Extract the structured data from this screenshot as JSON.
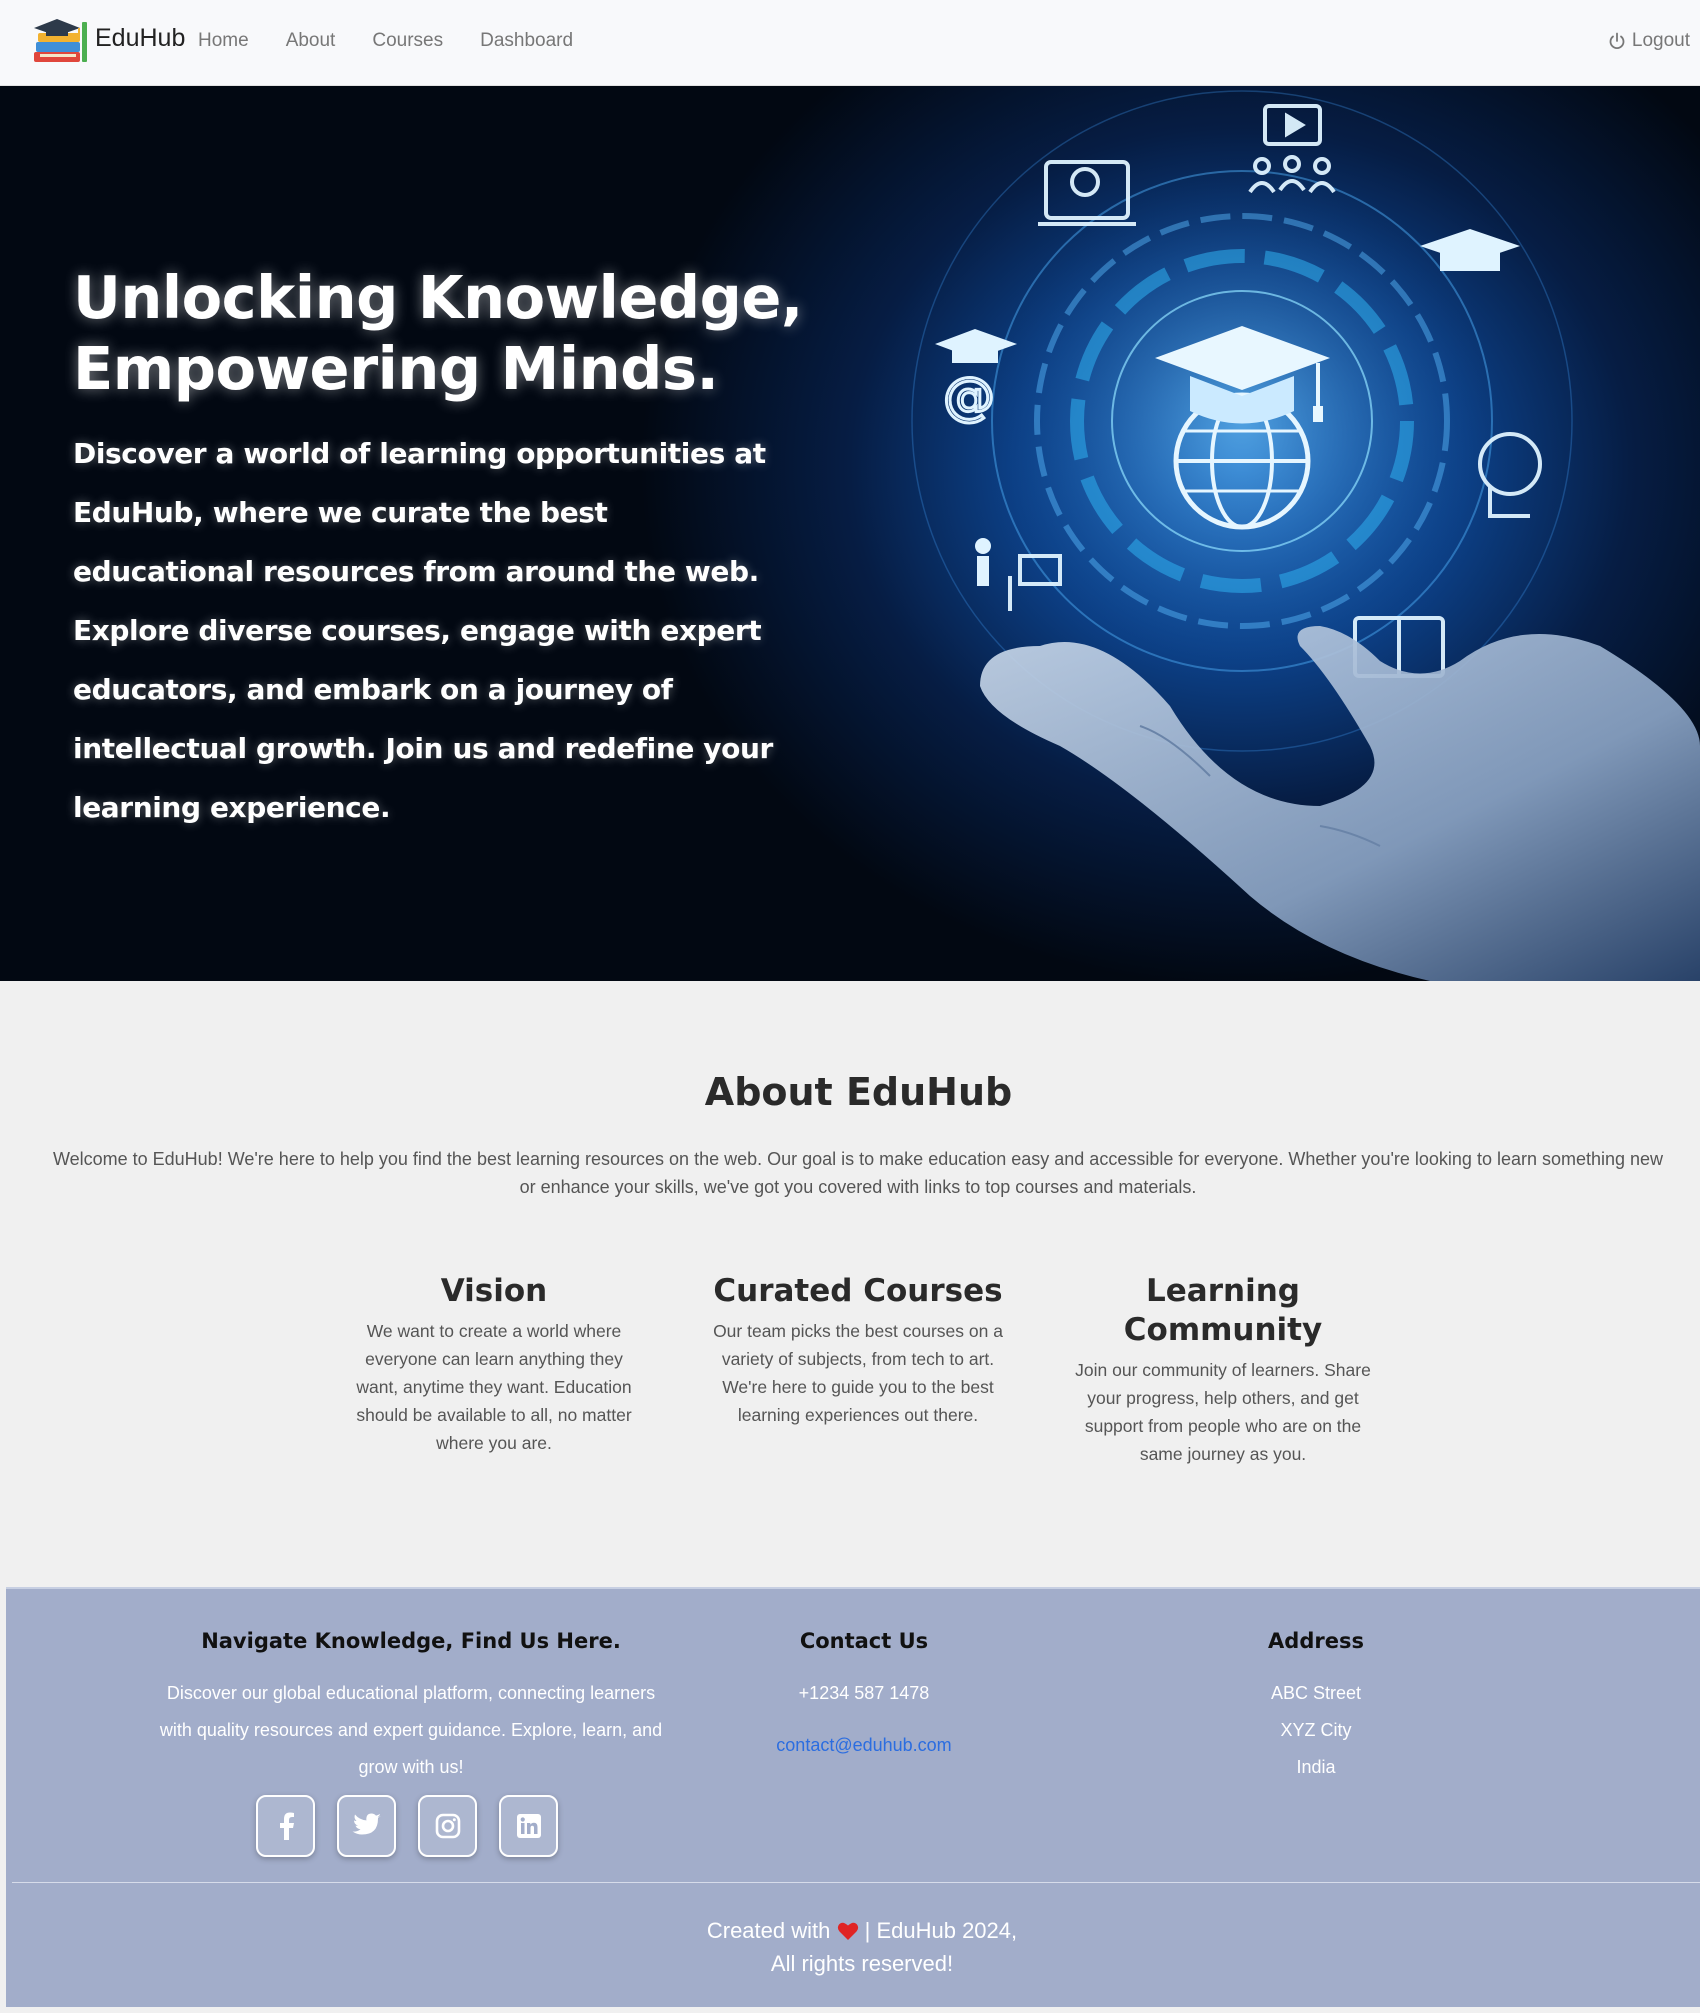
{
  "nav": {
    "brand": "EduHub",
    "links": [
      "Home",
      "About",
      "Courses",
      "Dashboard"
    ],
    "logout": "Logout"
  },
  "hero": {
    "title": "Unlocking Knowledge, Empowering Minds.",
    "text": "Discover a world of learning opportunities at EduHub, where we curate the best educational resources from around the web. Explore diverse courses, engage with expert educators, and embark on a journey of intellectual growth. Join us and redefine your learning experience."
  },
  "about": {
    "title": "About EduHub",
    "text": "Welcome to EduHub! We're here to help you find the best learning resources on the web. Our goal is to make education easy and accessible for everyone. Whether you're looking to learn something new or enhance your skills, we've got you covered with links to top courses and materials.",
    "columns": [
      {
        "title": "Vision",
        "text": "We want to create a world where everyone can learn anything they want, anytime they want. Education should be available to all, no matter where you are."
      },
      {
        "title": "Curated Courses",
        "text": "Our team picks the best courses on a variety of subjects, from tech to art. We're here to guide you to the best learning experiences out there."
      },
      {
        "title": "Learning Community",
        "text": "Join our community of learners. Share your progress, help others, and get support from people who are on the same journey as you."
      }
    ]
  },
  "footer": {
    "col1": {
      "title": "Navigate Knowledge, Find Us Here.",
      "text": "Discover our global educational platform, connecting learners with quality resources and expert guidance. Explore, learn, and grow with us!"
    },
    "col2": {
      "title": "Contact Us",
      "phone": "+1234 587 1478",
      "email": "contact@eduhub.com"
    },
    "col3": {
      "title": "Address",
      "lines": [
        "ABC Street",
        "XYZ City",
        "India"
      ]
    },
    "socials": [
      "facebook-icon",
      "twitter-icon",
      "instagram-icon",
      "linkedin-icon"
    ],
    "bottom_line1_pre": "Created with",
    "bottom_line1_post": "| EduHub 2024,",
    "bottom_line2": "All rights reserved!"
  },
  "colors": {
    "footer_bg": "#a2adca",
    "link": "#2b6de0",
    "hero_glow": "#1b6cc9"
  }
}
